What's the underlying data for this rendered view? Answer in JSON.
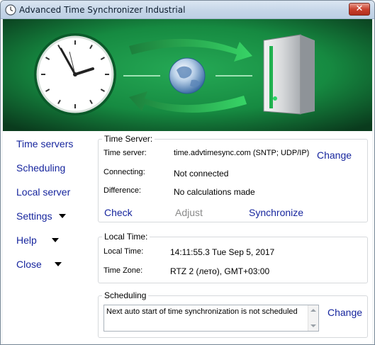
{
  "window": {
    "title": "Advanced Time Synchronizer Industrial",
    "close_glyph": "✕"
  },
  "sidebar": {
    "items": [
      {
        "label": "Time servers"
      },
      {
        "label": "Scheduling"
      },
      {
        "label": "Local server"
      },
      {
        "label": "Settings"
      },
      {
        "label": "Help"
      },
      {
        "label": "Close"
      }
    ]
  },
  "time_server": {
    "group_title": "Time Server:",
    "server_label": "Time server:",
    "server_value": "time.advtimesync.com (SNTP; UDP/IP)",
    "change_label": "Change",
    "connecting_label": "Connecting:",
    "connecting_value": "Not connected",
    "difference_label": "Difference:",
    "difference_value": "No calculations made",
    "check_label": "Check",
    "adjust_label": "Adjust",
    "synchronize_label": "Synchronize"
  },
  "local_time": {
    "group_title": "Local Time:",
    "time_label": "Local Time:",
    "time_value": "14:11:55.3 Tue Sep 5, 2017",
    "zone_label": "Time Zone:",
    "zone_value": "RTZ 2 (лето), GMT+03:00"
  },
  "scheduling": {
    "group_title": "Scheduling",
    "text": "Next auto start of time synchronization is not scheduled",
    "change_label": "Change"
  },
  "colors": {
    "banner_green": "#1f9a4c",
    "banner_dark": "#0c3a1e",
    "link_blue": "#17269e"
  },
  "icons": [
    "app-clock-icon",
    "close-icon",
    "wall-clock-icon",
    "globe-icon",
    "server-icon",
    "sync-arrow-icon",
    "dropdown-triangle-icon"
  ]
}
